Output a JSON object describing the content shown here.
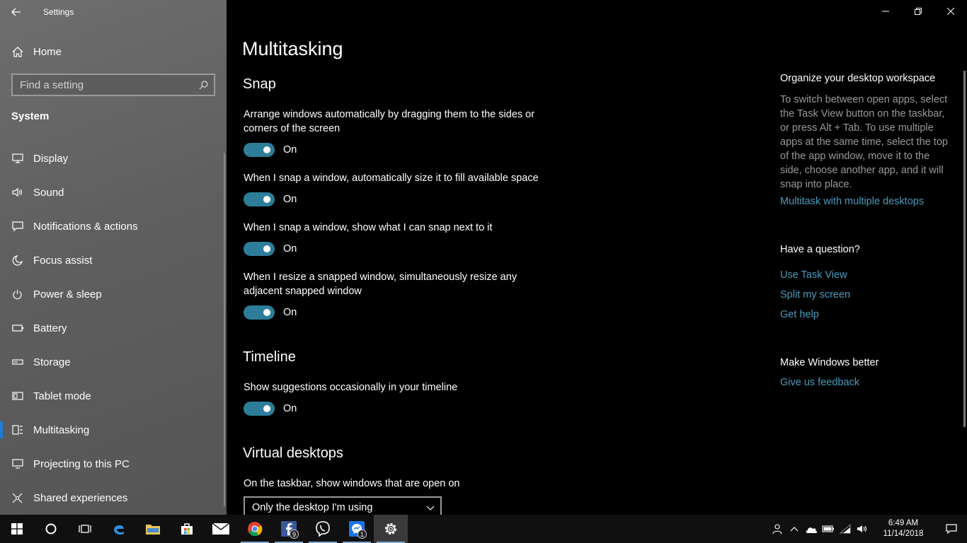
{
  "app": {
    "title": "Settings"
  },
  "sidebar": {
    "home_label": "Home",
    "search_placeholder": "Find a setting",
    "section": "System",
    "items": [
      {
        "label": "Display",
        "icon": "monitor-icon"
      },
      {
        "label": "Sound",
        "icon": "speaker-icon"
      },
      {
        "label": "Notifications & actions",
        "icon": "message-icon"
      },
      {
        "label": "Focus assist",
        "icon": "moon-icon"
      },
      {
        "label": "Power & sleep",
        "icon": "power-icon"
      },
      {
        "label": "Battery",
        "icon": "battery-icon"
      },
      {
        "label": "Storage",
        "icon": "storage-icon"
      },
      {
        "label": "Tablet mode",
        "icon": "tablet-icon"
      },
      {
        "label": "Multitasking",
        "icon": "multitask-icon",
        "active": true
      },
      {
        "label": "Projecting to this PC",
        "icon": "projector-icon"
      },
      {
        "label": "Shared experiences",
        "icon": "shared-icon"
      }
    ]
  },
  "main": {
    "title": "Multitasking",
    "snap": {
      "title": "Snap",
      "settings": [
        {
          "text": "Arrange windows automatically by dragging them to the sides or corners of the screen",
          "state": "On"
        },
        {
          "text": "When I snap a window, automatically size it to fill available space",
          "state": "On"
        },
        {
          "text": "When I snap a window, show what I can snap next to it",
          "state": "On"
        },
        {
          "text": "When I resize a snapped window, simultaneously resize any adjacent snapped window",
          "state": "On"
        }
      ]
    },
    "timeline": {
      "title": "Timeline",
      "setting": {
        "text": "Show suggestions occasionally in your timeline",
        "state": "On"
      }
    },
    "virtual_desktops": {
      "title": "Virtual desktops",
      "label": "On the taskbar, show windows that are open on",
      "selected": "Only the desktop I'm using"
    }
  },
  "info": {
    "organize_title": "Organize your desktop workspace",
    "organize_text": "To switch between open apps, select the Task View button on the taskbar, or press Alt + Tab. To use multiple apps at the same time, select the top of the app window, move it to the side, choose another app, and it will snap into place.",
    "organize_link": "Multitask with multiple desktops",
    "question_title": "Have a question?",
    "question_links": [
      "Use Task View",
      "Split my screen",
      "Get help"
    ],
    "better_title": "Make Windows better",
    "better_link": "Give us feedback"
  },
  "taskbar": {
    "time": "6:49 AM",
    "date": "11/14/2018",
    "facebook_badge": "9",
    "viber_badge": "1",
    "accent": "#2d7d9a"
  }
}
